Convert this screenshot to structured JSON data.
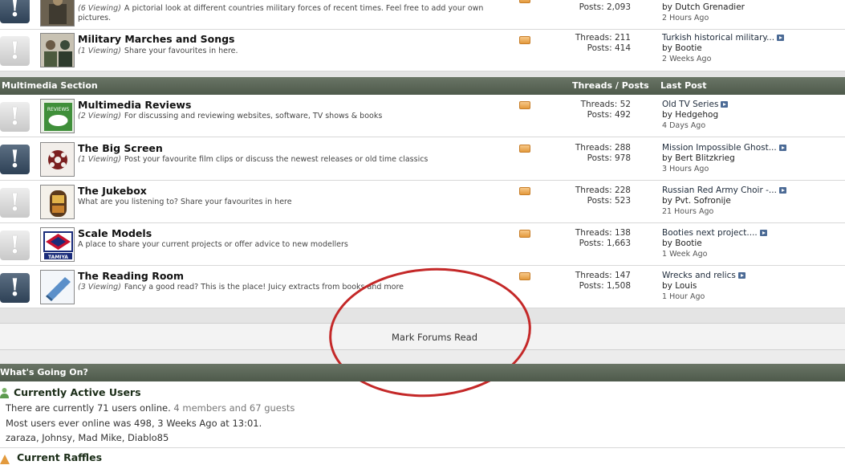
{
  "forums_top": [
    {
      "name_partial": "",
      "viewing": "(6 Viewing)",
      "description": "A pictorial look at different countries military forces of recent times. Feel free to add your own",
      "description2": "pictures.",
      "threads": "",
      "posts": "Posts: 2,093",
      "last_post_title": "",
      "last_post_by": "by Dutch Grenadier",
      "last_post_ago": "2 Hours Ago"
    },
    {
      "name": "Military Marches and Songs",
      "viewing": "(1 Viewing)",
      "description": "Share your favourites in here.",
      "threads": "Threads: 211",
      "posts": "Posts: 414",
      "last_post_title": "Turkish historical military...",
      "last_post_by": "by Bootie",
      "last_post_ago": "2 Weeks Ago"
    }
  ],
  "section": {
    "title": "Multimedia Section",
    "col_threads_posts": "Threads / Posts",
    "col_last_post": "Last Post"
  },
  "forums": [
    {
      "name": "Multimedia Reviews",
      "viewing": "(2 Viewing)",
      "description": "For discussing and reviewing websites, software, TV shows & books",
      "threads": "Threads: 52",
      "posts": "Posts: 492",
      "last_post_title": "Old TV Series",
      "last_post_by": "by Hedgehog",
      "last_post_ago": "4 Days Ago",
      "thumb_text": "REVIEWS"
    },
    {
      "name": "The Big Screen",
      "viewing": "(1 Viewing)",
      "description": "Post your favourite film clips or discuss the newest releases or old time classics",
      "threads": "Threads: 288",
      "posts": "Posts: 978",
      "last_post_title": "Mission Impossible Ghost...",
      "last_post_by": "by Bert Blitzkrieg",
      "last_post_ago": "3 Hours Ago"
    },
    {
      "name": "The Jukebox",
      "viewing": "",
      "description": "What are you listening to? Share your favourites in here",
      "threads": "Threads: 228",
      "posts": "Posts: 523",
      "last_post_title": "Russian Red Army Choir -...",
      "last_post_by": "by Pvt. Sofronije",
      "last_post_ago": "21 Hours Ago"
    },
    {
      "name": "Scale Models",
      "viewing": "",
      "description": "A place to share your current projects or offer advice to new modellers",
      "threads": "Threads: 138",
      "posts": "Posts: 1,663",
      "last_post_title": "Booties next project....",
      "last_post_by": "by Bootie",
      "last_post_ago": "1 Week Ago",
      "thumb_text": "TAMIYA"
    },
    {
      "name": "The Reading Room",
      "viewing": "(3 Viewing)",
      "description": "Fancy a good read? This is the place! Juicy extracts from books and more",
      "threads": "Threads: 147",
      "posts": "Posts: 1,508",
      "last_post_title": "Wrecks and relics",
      "last_post_by": "by Louis",
      "last_post_ago": "1 Hour Ago"
    }
  ],
  "mark_forums_read": "Mark Forums Read",
  "whats_going_on": {
    "title": "What's Going On?",
    "active_users": {
      "title": "Currently Active Users",
      "line1_prefix": "There are currently 71 users online.",
      "line1_suffix": "4 members and 67 guests",
      "line2": "Most users ever online was 498, 3 Weeks Ago at 13:01.",
      "line3": "zaraza, Johnsy, Mad Mike, Diablo85"
    },
    "raffles": {
      "title": "Current Raffles"
    }
  },
  "colors": {
    "section_header": "#5b6658",
    "status_new": "#3d5065",
    "annotation": "#c42828"
  },
  "icons": {
    "status_new": "exclamation-icon",
    "status_old": "exclamation-icon",
    "rss": "rss-feed-icon",
    "goto_post": "go-to-last-post-icon",
    "users": "user-group-icon",
    "raffle": "raffle-icon"
  }
}
